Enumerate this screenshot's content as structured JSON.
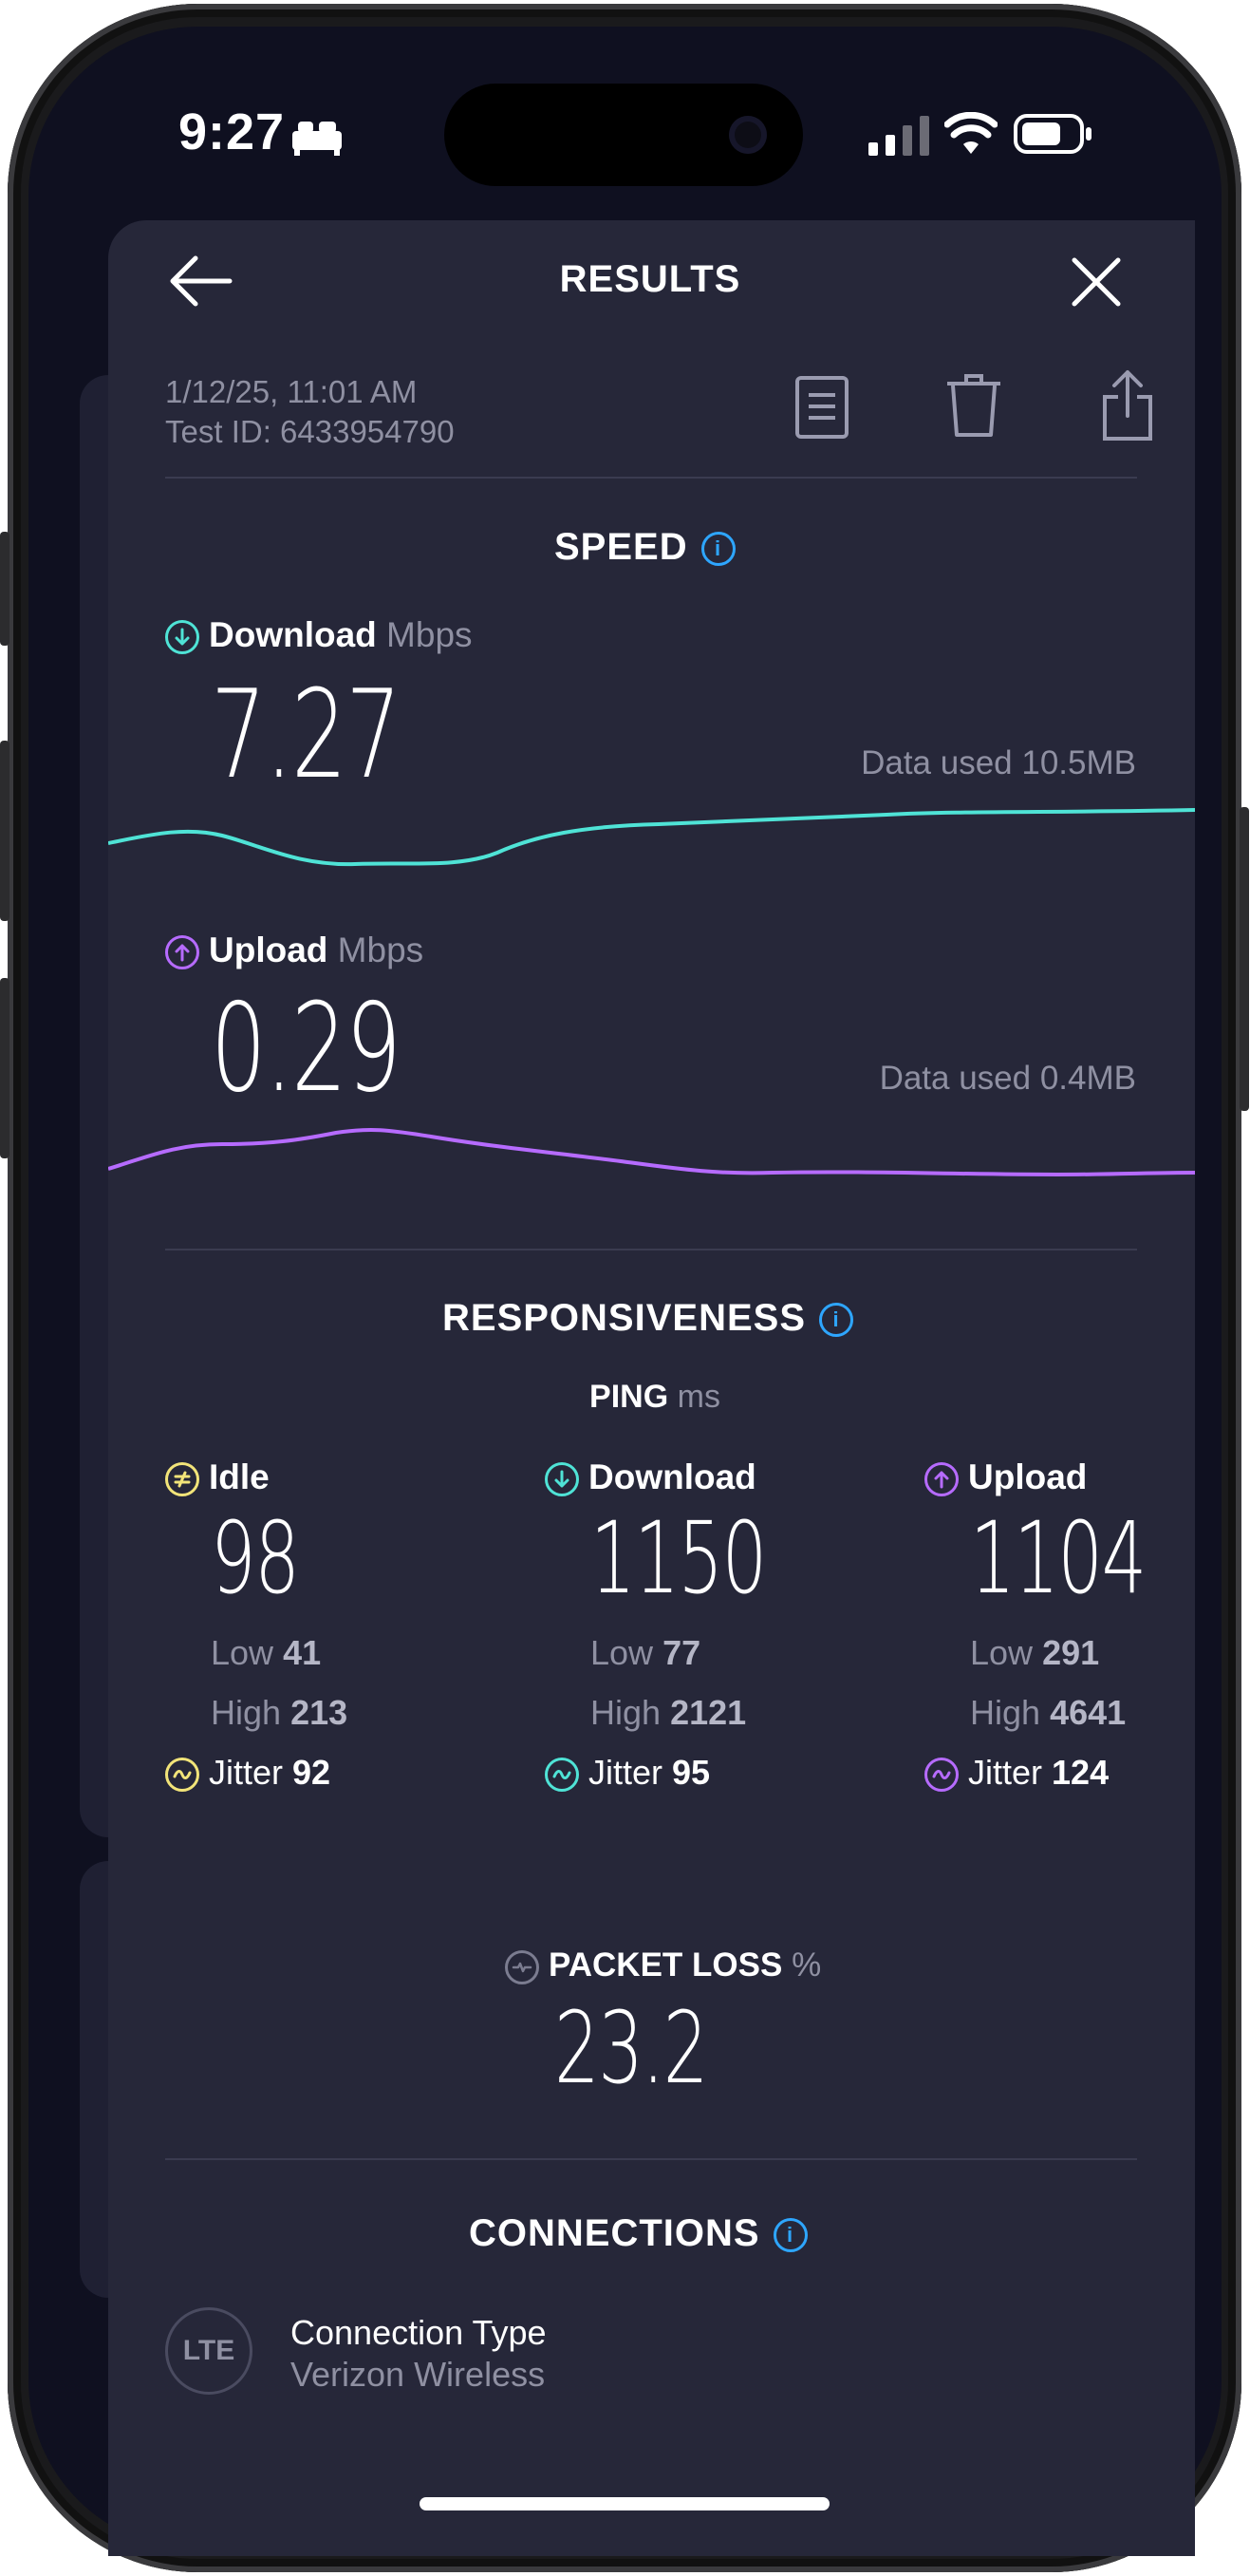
{
  "status_bar": {
    "time": "9:27"
  },
  "header": {
    "title": "RESULTS"
  },
  "meta": {
    "date": "1/12/25, 11:01 AM",
    "test_id": "Test ID: 6433954790"
  },
  "speed": {
    "title": "SPEED",
    "download": {
      "label": "Download",
      "unit": "Mbps",
      "value": "7.27",
      "data_used": "Data used 10.5MB"
    },
    "upload": {
      "label": "Upload",
      "unit": "Mbps",
      "value": "0.29",
      "data_used": "Data used 0.4MB"
    }
  },
  "responsiveness": {
    "title": "RESPONSIVENESS",
    "ping_label": "PING",
    "ping_unit": "ms",
    "idle": {
      "label": "Idle",
      "value": "98",
      "low_label": "Low",
      "low": "41",
      "high_label": "High",
      "high": "213",
      "jitter_label": "Jitter",
      "jitter": "92"
    },
    "download": {
      "label": "Download",
      "value": "1150",
      "low_label": "Low",
      "low": "77",
      "high_label": "High",
      "high": "2121",
      "jitter_label": "Jitter",
      "jitter": "95"
    },
    "upload": {
      "label": "Upload",
      "value": "1104",
      "low_label": "Low",
      "low": "291",
      "high_label": "High",
      "high": "4641",
      "jitter_label": "Jitter",
      "jitter": "124"
    }
  },
  "packet_loss": {
    "label": "PACKET LOSS",
    "unit": "%",
    "value": "23.2"
  },
  "connections": {
    "title": "CONNECTIONS",
    "badge": "LTE",
    "type_label": "Connection Type",
    "provider": "Verizon Wireless"
  },
  "colors": {
    "download": "#4fe3d6",
    "upload": "#b66bff",
    "idle": "#f2e479",
    "info": "#2ea6ff"
  },
  "icons": [
    "back-arrow-icon",
    "close-icon",
    "document-icon",
    "trash-icon",
    "share-icon",
    "info-icon",
    "download-arrow-icon",
    "upload-arrow-icon",
    "idle-icon",
    "jitter-icon",
    "packet-loss-icon"
  ]
}
